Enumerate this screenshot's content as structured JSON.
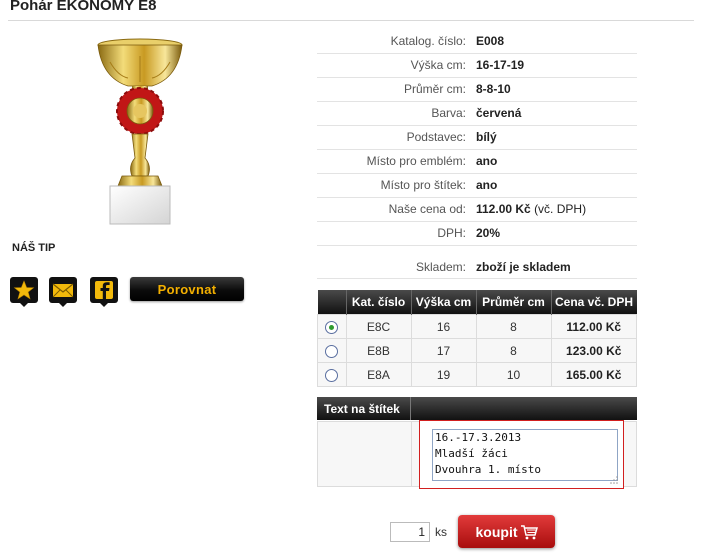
{
  "page": {
    "title": "Pohár EKONOMY E8"
  },
  "product_image": {
    "alt": "trophy-cup-image"
  },
  "tip": {
    "label": "NÁŠ TIP"
  },
  "actions": {
    "favorite_icon": "star-icon",
    "email_icon": "envelope-icon",
    "facebook_icon": "facebook-icon",
    "compare_label": "Porovnat"
  },
  "specs": [
    {
      "label": "Katalog. číslo:",
      "value": "E008"
    },
    {
      "label": "Výška cm:",
      "value": "16-17-19"
    },
    {
      "label": "Průměr cm:",
      "value": "8-8-10"
    },
    {
      "label": "Barva:",
      "value": "červená"
    },
    {
      "label": "Podstavec:",
      "value": "bílý"
    },
    {
      "label": "Místo pro emblém:",
      "value": "ano"
    },
    {
      "label": "Místo pro štítek:",
      "value": "ano"
    },
    {
      "label": "Naše cena od:",
      "value": "112.00 Kč",
      "value_suffix": "(vč. DPH)"
    },
    {
      "label": "DPH:",
      "value": "20%"
    },
    {
      "label": "Skladem:",
      "value": "zboží je skladem"
    }
  ],
  "variants": {
    "headers": [
      "Kat. číslo",
      "Výška cm",
      "Průměr cm",
      "Cena vč. DPH"
    ],
    "rows": [
      {
        "selected": true,
        "code": "E8C",
        "height": "16",
        "diameter": "8",
        "price": "112.00 Kč"
      },
      {
        "selected": false,
        "code": "E8B",
        "height": "17",
        "diameter": "8",
        "price": "123.00 Kč"
      },
      {
        "selected": false,
        "code": "E8A",
        "height": "19",
        "diameter": "10",
        "price": "165.00 Kč"
      }
    ]
  },
  "label_text": {
    "heading": "Text na štítek",
    "value": "16.-17.3.2013\nMladší žáci\nDvouhra 1. místo"
  },
  "purchase": {
    "quantity": "1",
    "unit": "ks",
    "buy_label": "koupit"
  },
  "colors": {
    "accent_red": "#d21f1f",
    "compare_text": "#f4b000"
  }
}
